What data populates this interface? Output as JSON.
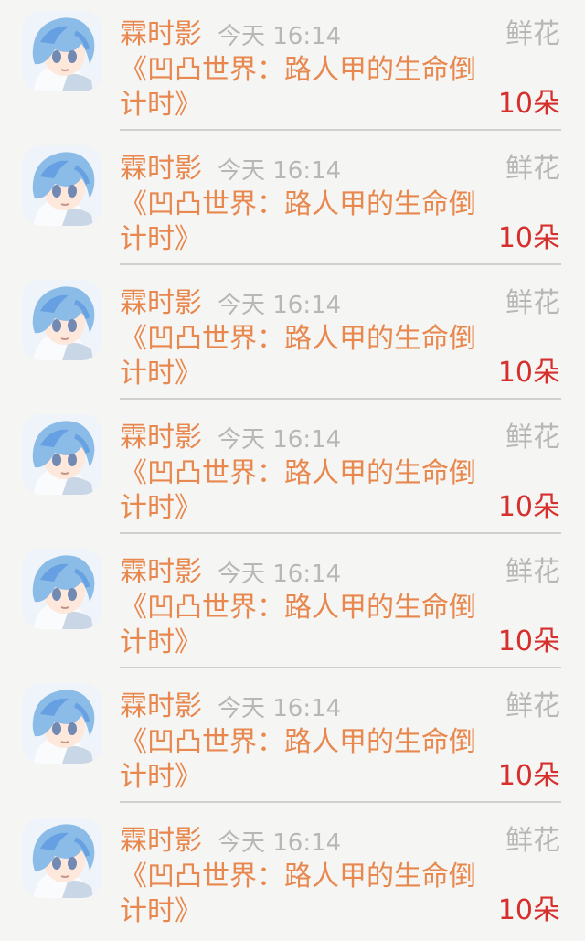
{
  "notifications": [
    {
      "sender": "霖时影",
      "time": "今天 16:14",
      "gift_label": "鲜花",
      "title": "《凹凸世界：路人甲的生命倒计时》",
      "count": "10朵",
      "avatar_icon": "anime-boy-blue-hair-avatar-icon"
    },
    {
      "sender": "霖时影",
      "time": "今天 16:14",
      "gift_label": "鲜花",
      "title": "《凹凸世界：路人甲的生命倒计时》",
      "count": "10朵",
      "avatar_icon": "anime-boy-blue-hair-avatar-icon"
    },
    {
      "sender": "霖时影",
      "time": "今天 16:14",
      "gift_label": "鲜花",
      "title": "《凹凸世界：路人甲的生命倒计时》",
      "count": "10朵",
      "avatar_icon": "anime-boy-blue-hair-avatar-icon"
    },
    {
      "sender": "霖时影",
      "time": "今天 16:14",
      "gift_label": "鲜花",
      "title": "《凹凸世界：路人甲的生命倒计时》",
      "count": "10朵",
      "avatar_icon": "anime-boy-blue-hair-avatar-icon"
    },
    {
      "sender": "霖时影",
      "time": "今天 16:14",
      "gift_label": "鲜花",
      "title": "《凹凸世界：路人甲的生命倒计时》",
      "count": "10朵",
      "avatar_icon": "anime-boy-blue-hair-avatar-icon"
    },
    {
      "sender": "霖时影",
      "time": "今天 16:14",
      "gift_label": "鲜花",
      "title": "《凹凸世界：路人甲的生命倒计时》",
      "count": "10朵",
      "avatar_icon": "anime-boy-blue-hair-avatar-icon"
    },
    {
      "sender": "霖时影",
      "time": "今天 16:14",
      "gift_label": "鲜花",
      "title": "《凹凸世界：路人甲的生命倒计时》",
      "count": "10朵",
      "avatar_icon": "anime-boy-blue-hair-avatar-icon"
    }
  ],
  "colors": {
    "background": "#f5f5f3",
    "sender_text": "#e8884f",
    "title_text": "#e8884f",
    "muted_text": "#b7b7b7",
    "count_text": "#d6302e",
    "divider": "#cfcfcf"
  }
}
